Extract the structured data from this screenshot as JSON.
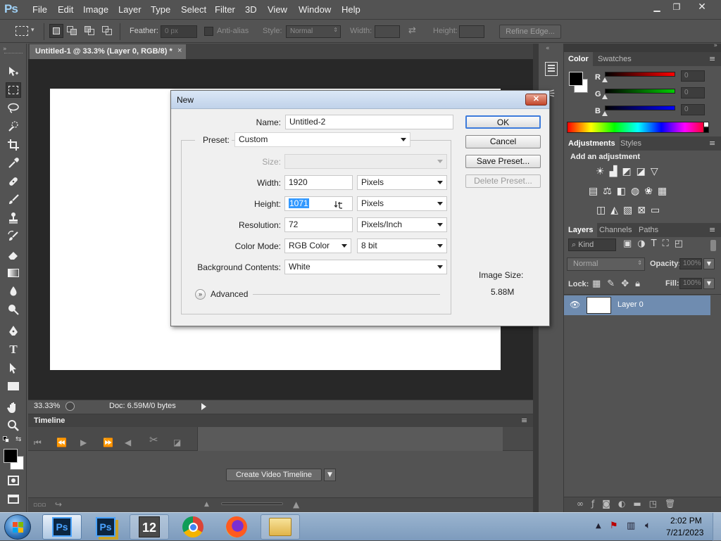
{
  "app": {
    "logo": "Ps"
  },
  "menu": [
    "File",
    "Edit",
    "Image",
    "Layer",
    "Type",
    "Select",
    "Filter",
    "3D",
    "View",
    "Window",
    "Help"
  ],
  "options_bar": {
    "feather_label": "Feather:",
    "feather_value": "0 px",
    "anti_alias_label": "Anti-alias",
    "style_label": "Style:",
    "style_value": "Normal",
    "width_label": "Width:",
    "height_label": "Height:",
    "refine_edge": "Refine Edge..."
  },
  "document": {
    "tab_title": "Untitled-1 @ 33.3% (Layer 0, RGB/8) *",
    "close": "×",
    "zoom": "33.33%",
    "doc_info": "Doc: 6.59M/0 bytes"
  },
  "timeline": {
    "title": "Timeline",
    "create_button": "Create Video Timeline"
  },
  "color_panel": {
    "tabs": [
      "Color",
      "Swatches"
    ],
    "channels": [
      {
        "label": "R",
        "value": "0",
        "color": "#ff0000"
      },
      {
        "label": "G",
        "value": "0",
        "color": "#00cc00"
      },
      {
        "label": "B",
        "value": "0",
        "color": "#0000ff"
      }
    ]
  },
  "adjustments_panel": {
    "tabs": [
      "Adjustments",
      "Styles"
    ],
    "heading": "Add an adjustment"
  },
  "layers_panel": {
    "tabs": [
      "Layers",
      "Channels",
      "Paths"
    ],
    "kind_label": "Kind",
    "blend_mode": "Normal",
    "opacity_label": "Opacity:",
    "opacity_value": "100%",
    "lock_label": "Lock:",
    "fill_label": "Fill:",
    "fill_value": "100%",
    "layers": [
      {
        "name": "Layer 0"
      }
    ]
  },
  "dialog": {
    "title": "New",
    "name_label": "Name:",
    "name_value": "Untitled-2",
    "preset_label": "Preset:",
    "preset_value": "Custom",
    "size_label": "Size:",
    "width_label": "Width:",
    "width_value": "1920",
    "width_unit": "Pixels",
    "height_label": "Height:",
    "height_value": "1071",
    "height_unit": "Pixels",
    "resolution_label": "Resolution:",
    "resolution_value": "72",
    "resolution_unit": "Pixels/Inch",
    "color_mode_label": "Color Mode:",
    "color_mode_value": "RGB Color",
    "bit_depth": "8 bit",
    "background_label": "Background Contents:",
    "background_value": "White",
    "advanced_label": "Advanced",
    "image_size_label": "Image Size:",
    "image_size_value": "5.88M",
    "buttons": {
      "ok": "OK",
      "cancel": "Cancel",
      "save_preset": "Save Preset...",
      "delete_preset": "Delete Preset..."
    }
  },
  "taskbar": {
    "time": "2:02 PM",
    "date": "7/21/2023",
    "ps_label": "Ps",
    "wb_label": "12"
  }
}
